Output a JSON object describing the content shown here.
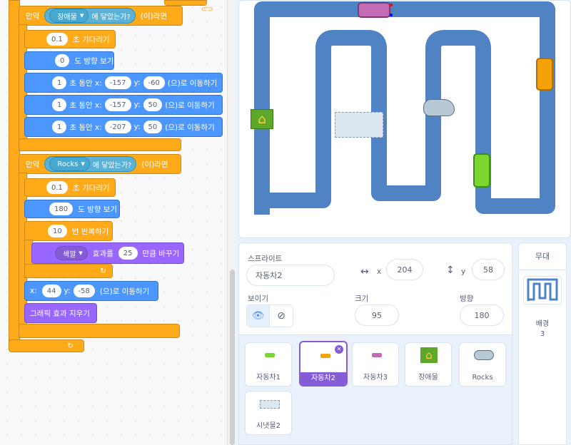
{
  "code": {
    "if_label": "만약",
    "then_label": "(이)라면",
    "touching_suffix": "에 닿았는가?",
    "block1": {
      "target": "장애물"
    },
    "wait1": {
      "value": "0.1",
      "label": "초 기다리기"
    },
    "point1": {
      "value": "0",
      "label": "도 방향 보기"
    },
    "glide_label": "초 동안 x:",
    "glide_y": "y:",
    "glide_suffix": "(으)로 이동하기",
    "glides": [
      {
        "secs": "1",
        "x": "-157",
        "y": "-60"
      },
      {
        "secs": "1",
        "x": "-157",
        "y": "50"
      },
      {
        "secs": "1",
        "x": "-207",
        "y": "50"
      }
    ],
    "block2": {
      "target": "Rocks"
    },
    "wait2": {
      "value": "0.1",
      "label": "초 기다리기"
    },
    "point2": {
      "value": "180",
      "label": "도 방향 보기"
    },
    "repeat": {
      "value": "10",
      "label": "번 반복하기"
    },
    "effect": {
      "name": "색깔",
      "label": "효과를",
      "value": "25",
      "suffix": "만큼 바꾸기"
    },
    "goto": {
      "x_label": "x:",
      "x": "44",
      "y_label": "y:",
      "y": "-58",
      "suffix": "(으)로 이동하기"
    },
    "clear_effects": "그래픽 효과 지우기"
  },
  "sprite_info": {
    "sprite_label": "스프라이트",
    "sprite_name": "자동차2",
    "x_label": "x",
    "x_value": "204",
    "y_label": "y",
    "y_value": "58",
    "show_label": "보이기",
    "size_label": "크기",
    "size_value": "95",
    "direction_label": "방향",
    "direction_value": "180"
  },
  "sprites": [
    {
      "name": "자동차1",
      "selected": false
    },
    {
      "name": "자동차2",
      "selected": true
    },
    {
      "name": "자동차3",
      "selected": false
    },
    {
      "name": "장애물",
      "selected": false
    },
    {
      "name": "Rocks",
      "selected": false
    },
    {
      "name": "시냇물2",
      "selected": false
    }
  ],
  "stage_panel": {
    "title": "무대",
    "backdrop_label": "배경",
    "backdrop_count": "3"
  },
  "colors": {
    "track": "#4f83c4",
    "car_pink": "#c46bb5",
    "car_orange": "#f5a20a",
    "car_green": "#7bd62f",
    "house_green": "#5da82a"
  }
}
